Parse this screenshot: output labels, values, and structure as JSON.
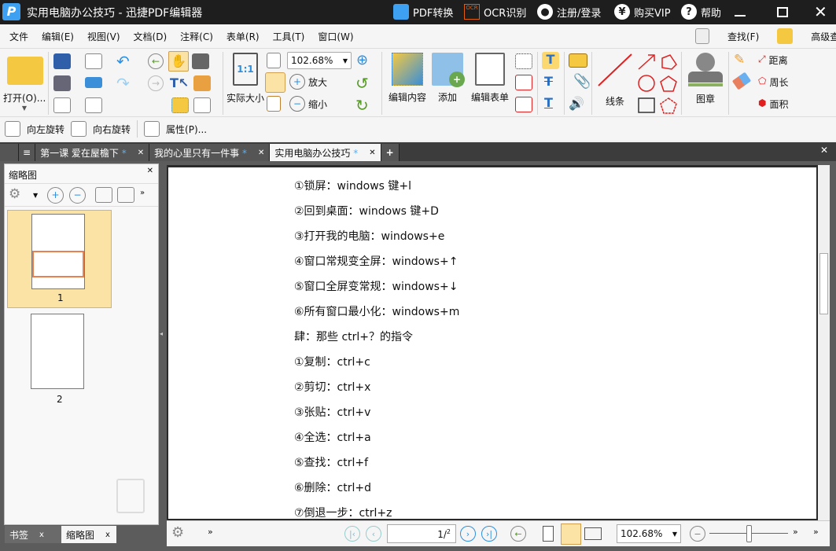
{
  "window": {
    "title": "实用电脑办公技巧 - 迅捷PDF编辑器",
    "pdf_convert": "PDF转换",
    "ocr": "OCR识别",
    "login": "注册/登录",
    "vip": "购买VIP",
    "help": "帮助",
    "ocr_icon_text": "OCR"
  },
  "menu": [
    "文件",
    "编辑(E)",
    "视图(V)",
    "文档(D)",
    "注释(C)",
    "表单(R)",
    "工具(T)",
    "窗口(W)"
  ],
  "search": {
    "find": "查找(F)",
    "advanced": "高级查找(S)"
  },
  "ribbon": {
    "open": "打开(O)...",
    "actual_size": "实际大小",
    "actual_size_icon": "1:1",
    "zoom_value": "102.68%",
    "zoom_in": "放大",
    "zoom_out": "缩小",
    "edit_content": "编辑内容",
    "add": "添加",
    "edit_form": "编辑表单",
    "lines": "线条",
    "stamp": "图章",
    "distance": "距离",
    "perimeter": "周长",
    "area": "面积"
  },
  "ribbon2": {
    "rotate_left": "向左旋转",
    "rotate_right": "向右旋转",
    "properties": "属性(P)..."
  },
  "tabs": [
    {
      "label": "第一课  爱在屋檐下",
      "mod": "*"
    },
    {
      "label": "我的心里只有一件事",
      "mod": "*"
    },
    {
      "label": "实用电脑办公技巧",
      "mod": "*"
    }
  ],
  "panel": {
    "title": "缩略图",
    "pages": [
      "1",
      "2"
    ],
    "bottom_tabs": [
      "书签",
      "缩略图"
    ]
  },
  "document": {
    "lines": [
      "①锁屏：windows 键+l",
      "②回到桌面：windows 键+D",
      "③打开我的电脑：windows+e",
      "④窗口常规变全屏：windows+↑",
      "⑤窗口全屏变常规：windows+↓",
      "⑥所有窗口最小化：windows+m",
      "肆：那些 ctrl+？的指令",
      "①复制：ctrl+c",
      "②剪切：ctrl+x",
      "③张贴：ctrl+v",
      "④全选：ctrl+a",
      "⑤查找：ctrl+f",
      "⑥删除：ctrl+d",
      "⑦倒退一步：ctrl+z"
    ]
  },
  "statusbar": {
    "page_current": "1",
    "page_total": "2",
    "zoom": "102.68%",
    "zoom_slider": 0.5
  },
  "colors": {
    "titlebar": "#1e1e1e",
    "accent": "#2d8fe0",
    "active_thumb": "#fbe3a6"
  }
}
